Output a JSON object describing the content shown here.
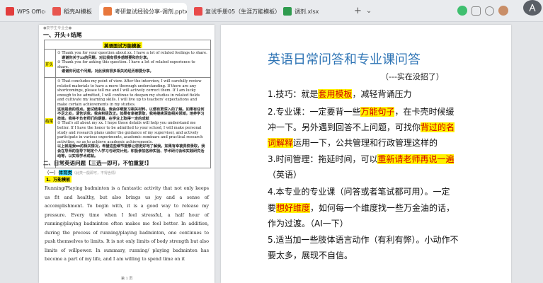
{
  "tabs": {
    "wps": "WPS Office",
    "t1": "稻壳AI模板",
    "t2": "考研复试经验分享-调剂.pptx",
    "t3": "复试手册05（生涯万能模板）.pdf",
    "t4": "调剂.xlsx",
    "close": "×",
    "new": "+",
    "dropdown": "⌄"
  },
  "left_doc": {
    "page_header_note": "●复学生专业全●",
    "sec1": "一、开头+结尾",
    "box_title": "英语面试万能模板",
    "open_label": "开头",
    "close_label": "结尾",
    "open_en1": "① Thank you for your question about xx. I have a lot of related feelings to share.",
    "open_cn1": "谢谢你关于xx的问题，对此我有很多感想要和你分享。",
    "open_en2": "② Thank you for asking this question. I have a lot of related experience to share.",
    "open_cn2": "谢谢你问这个问题，对此我有很多相关的经历想要分享。",
    "close_en1": "① That concludes my point of view. After the interview, I will carefully review related materials to have a more thorough understanding. If there are any shortcomings, please tell me and I will actively correct them. If I am lucky enough to be admitted, I will continue to deepen my studies in related fields and cultivate my learning skills. I will live up to teachers' expectations and make certain achievements in my studies.",
    "close_cn1": "这就是我的观点。面试结束后，我会仔细复习相关材料，以便有更深入的了解。如果有任何不足之处，请告诉我，我会积极改正。如果有幸被录取，我将继续深造相关领域，培养学习技能。我将不负老师们的期望，在学业上取得一定的成就",
    "close_en2": "② That's all about my xx. I hope these details will help you understand me better. If I have the honor to be admitted to your school, I will make personal study and research plans under the guidance of my supervisor, and actively participate in various experiments, academic seminars and practical research activities, so as to achieve academic achievements.",
    "close_cn2": "以上就是我xx的相关情况，希望这些细节能够让您更好地了解我。如果有幸被贵校录取，我会在导师的指导下制定个人学习与研究计划，积极参加各种实验、学术研讨会和实践研究活动等，以实现学术成就。",
    "sec2": "二、日常英语问题【三选一即可，不怕重复!】",
    "sub1_prefix": "（一）",
    "sub1": "体育类",
    "sub1_note": "（此类一般即可，不得含情）",
    "templ": "1、万能模板",
    "para": "Running/Playing badminton is a fantastic activity that not only keeps us fit and healthy, but also brings us joy and a sense of accomplishment. To begin with, it is a good way to release my pressure. Every time when I feel stressful, a half hour of running/playing badminton often makes me feel better. In addition, during the process of running/playing badminton, one continues to push themselves to limits. It is not only limits of body strength but also limits of willpower. In summary, running/ playing badminton has become a part of my life, and I am willing to spend time on it",
    "page_num": "第 1 页"
  },
  "slide": {
    "title": "英语日常问答和专业课问答",
    "subtitle": "（---实在没招了）",
    "l1a": "1.技巧：就是",
    "l1h": "套用模板",
    "l1b": "，减轻背诵压力",
    "l2a": "2.专业课：一定要背一些",
    "l2h": "万能句子",
    "l2b": "，在卡壳时候缓",
    "l2c": "冲一下。另外遇到回答不上问题，可找你",
    "l2h2": "背过的名",
    "l2h3": "词解释",
    "l2d": "运用一下，公共管理和行政管理这样的",
    "l3a": "3.时间管理：拖延时间，可以",
    "l3h": "重新请老师再说一遍",
    "l3b": "（英语）",
    "l4a": "4.本专业的专业课（问答或者笔试都可用）。一定",
    "l4b": "要",
    "l4h": "想好维度",
    "l4c": "，如何每一个维度找一些万金油的话，",
    "l4d": "作为过渡。（AI一下）",
    "l5a": "5.适当加一些肢体语言动作（有利有弊）。小动作不",
    "l5b": "要太多，展现不自信。"
  },
  "colors": {
    "accent_red": "#d40000",
    "highlight": "#fff200",
    "slide_title": "#2e74b5"
  },
  "icons": {
    "search": "search-icon",
    "menu": "menu-icon"
  }
}
